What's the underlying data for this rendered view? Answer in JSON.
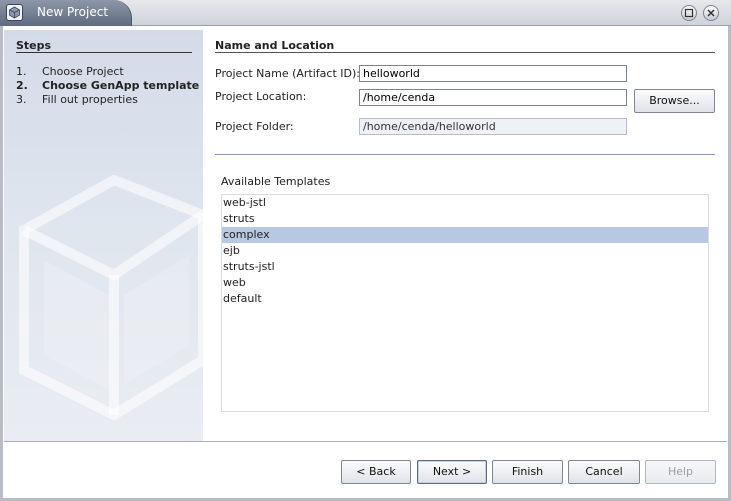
{
  "window": {
    "title": "New Project"
  },
  "steps": {
    "title": "Steps",
    "items": [
      {
        "num": "1.",
        "label": "Choose Project"
      },
      {
        "num": "2.",
        "label": "Choose GenApp template"
      },
      {
        "num": "3.",
        "label": "Fill out properties"
      }
    ],
    "current_index": 1
  },
  "form": {
    "section_title": "Name and Location",
    "project_name": {
      "label": "Project Name (Artifact ID):",
      "value": "helloworld"
    },
    "project_location": {
      "label": "Project Location:",
      "value": "/home/cenda"
    },
    "project_folder": {
      "label": "Project Folder:",
      "value": "/home/cenda/helloworld"
    },
    "browse_label": "Browse..."
  },
  "templates": {
    "label": "Available Templates",
    "items": [
      "web-jstl",
      "struts",
      "complex",
      "ejb",
      "struts-jstl",
      "web",
      "default"
    ],
    "selected": "complex"
  },
  "buttons": {
    "back": "< Back",
    "next": "Next >",
    "finish": "Finish",
    "cancel": "Cancel",
    "help": "Help"
  },
  "colors": {
    "selection": "#b8c8e0",
    "title_tab": "#6b7690",
    "steps_panel": "#d9e0ec"
  }
}
